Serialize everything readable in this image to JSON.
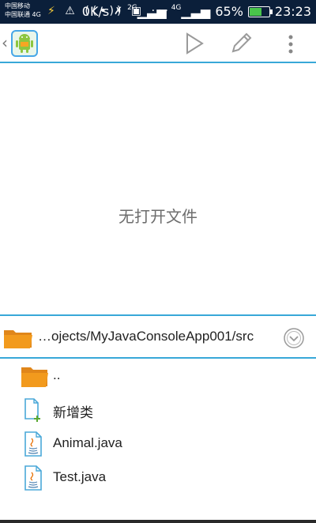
{
  "status_bar": {
    "carrier_1": "中国移动",
    "carrier_2": "中国联通 4G",
    "icons": [
      "lightning-icon",
      "warning-icon",
      "hotspot-icon",
      "image-icon",
      "more-icon"
    ],
    "more": "···",
    "net_speed": "0K/s",
    "net_2g": "2G",
    "net_4g": "4G",
    "battery_percent": "65%",
    "battery_level": 0.65,
    "time": "23:23"
  },
  "toolbar": {
    "icons": [
      "app-android-icon",
      "run-icon",
      "edit-icon",
      "overflow-menu-icon"
    ]
  },
  "editor": {
    "empty_message": "无打开文件"
  },
  "file_browser": {
    "path": "…ojects/MyJavaConsoleApp001/src",
    "items": [
      {
        "label": "..",
        "icon": "folder-icon"
      },
      {
        "label": "新增类",
        "icon": "new-class-icon"
      },
      {
        "label": "Animal.java",
        "icon": "java-file-icon"
      },
      {
        "label": "Test.java",
        "icon": "java-file-icon"
      }
    ]
  },
  "colors": {
    "accent": "#38a8d8",
    "folder": "#f29a1d",
    "status_bar": "#0b1f3a"
  }
}
